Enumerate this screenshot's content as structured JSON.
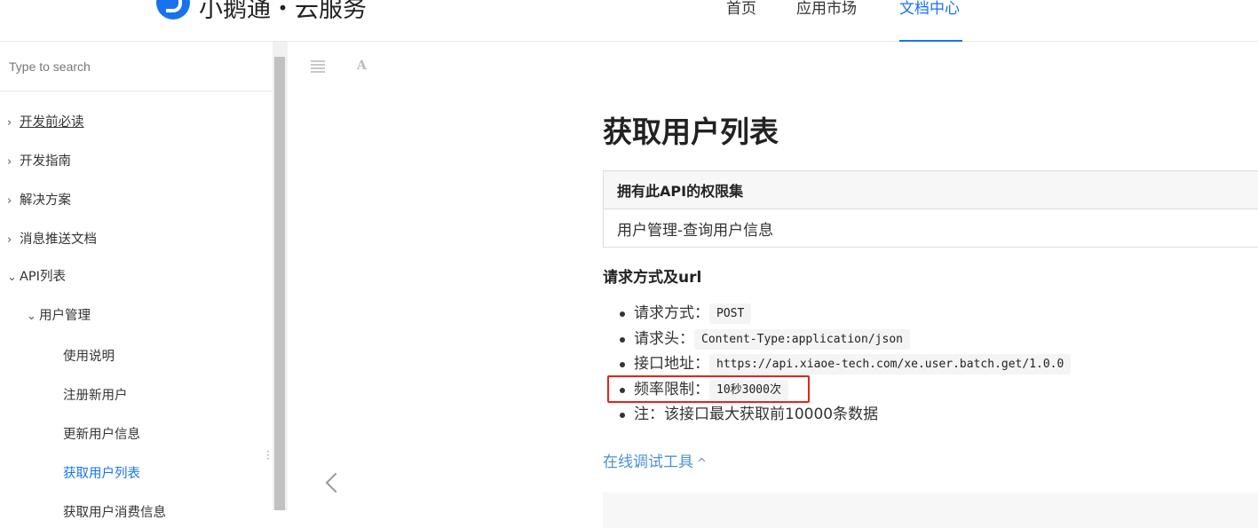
{
  "header": {
    "logo_text": "小鹅通・云服务",
    "nav": [
      {
        "label": "首页"
      },
      {
        "label": "应用市场"
      },
      {
        "label": "文档中心"
      }
    ]
  },
  "sidebar": {
    "search_placeholder": "Type to search",
    "items": [
      {
        "label": "开发前必读",
        "chevron": "›"
      },
      {
        "label": "开发指南",
        "chevron": "›"
      },
      {
        "label": "解决方案",
        "chevron": "›"
      },
      {
        "label": "消息推送文档",
        "chevron": "›"
      },
      {
        "label": "API列表",
        "chevron": "⌄"
      },
      {
        "label": "用户管理",
        "chevron": "⌄"
      },
      {
        "label": "使用说明"
      },
      {
        "label": "注册新用户"
      },
      {
        "label": "更新用户信息"
      },
      {
        "label": "获取用户列表"
      },
      {
        "label": "获取用户消费信息"
      }
    ]
  },
  "toolbar": {
    "list_icon": "list-icon",
    "font_icon": "A"
  },
  "content": {
    "title": "获取用户列表",
    "perm_table": {
      "header": "拥有此API的权限集",
      "value": "用户管理-查询用户信息"
    },
    "section_title": "请求方式及url",
    "requests": [
      {
        "label": "请求方式：",
        "code": "POST"
      },
      {
        "label": "请求头：",
        "code": "Content-Type:application/json"
      },
      {
        "label": "接口地址：",
        "code": "https://api.xiaoe-tech.com/xe.user.batch.get/1.0.0"
      },
      {
        "label": "频率限制：",
        "code": "10秒3000次"
      },
      {
        "label": "注：该接口最大获取前10000条数据",
        "code": null
      }
    ],
    "online_tool": "在线调试工具",
    "online_tool_caret": "^"
  },
  "colors": {
    "accent": "#1872f0",
    "link": "#4a90d9",
    "highlight": "#e8221a"
  }
}
